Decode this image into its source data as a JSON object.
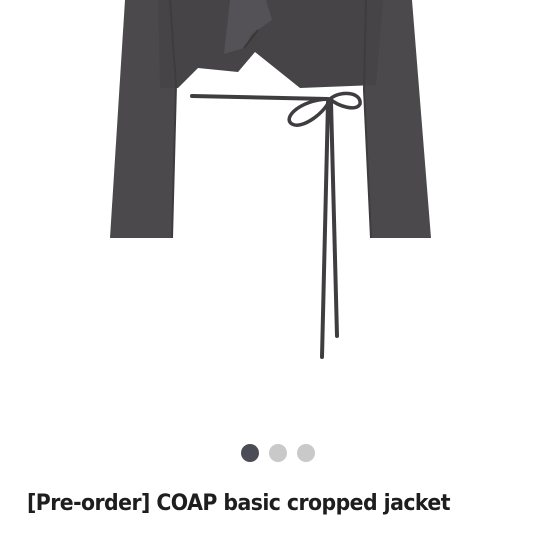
{
  "product": {
    "image_subject": "cropped-jacket-photo",
    "jacket_color": "#4a484b",
    "title": "[Pre-order] COAP basic cropped jacket"
  },
  "carousel": {
    "total_slides": 3,
    "active_index": 0,
    "active_color": "#4a4d55",
    "inactive_color": "#c9c9c9"
  }
}
